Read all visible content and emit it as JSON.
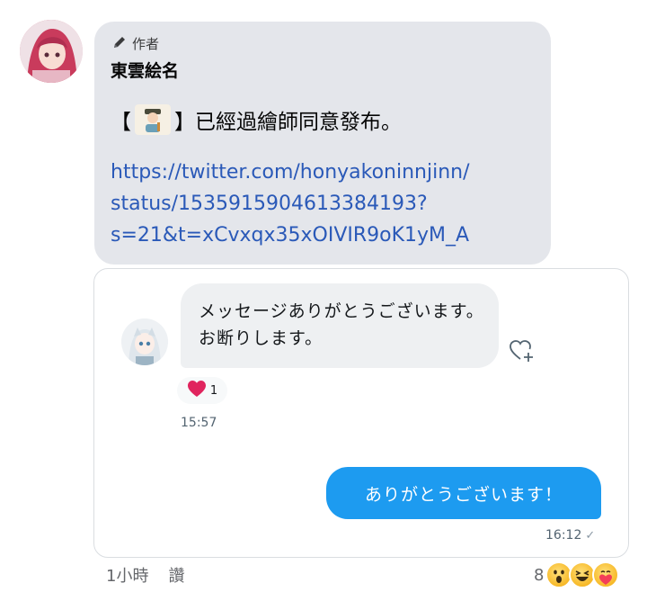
{
  "comment": {
    "author_role": "作者",
    "author_name": "東雲絵名",
    "text_open": "【",
    "text_close": "】已經過繪師同意發布。",
    "link_lines": [
      "https://twitter.com/honyakoninnjinn/",
      "status/1535915904613384193?",
      "s=21&t=xCvxqx35xOIVIR9oK1yM_A"
    ],
    "footer_time": "1小時",
    "footer_like": "讚",
    "reaction_total": "8",
    "reaction_icons": [
      "wow-emoji-icon",
      "haha-emoji-icon",
      "care-emoji-icon"
    ]
  },
  "dm": {
    "incoming_text": "メッセージありがとうございます。お断りします。",
    "reaction_count": "1",
    "incoming_time": "15:57",
    "outgoing_text": "ありがとうございます！",
    "outgoing_time": "16:12"
  },
  "colors": {
    "comment_bg": "#e4e6eb",
    "link": "#2a59b8",
    "outgoing_bubble": "#1d9bf0",
    "heart": "#e0245e"
  }
}
